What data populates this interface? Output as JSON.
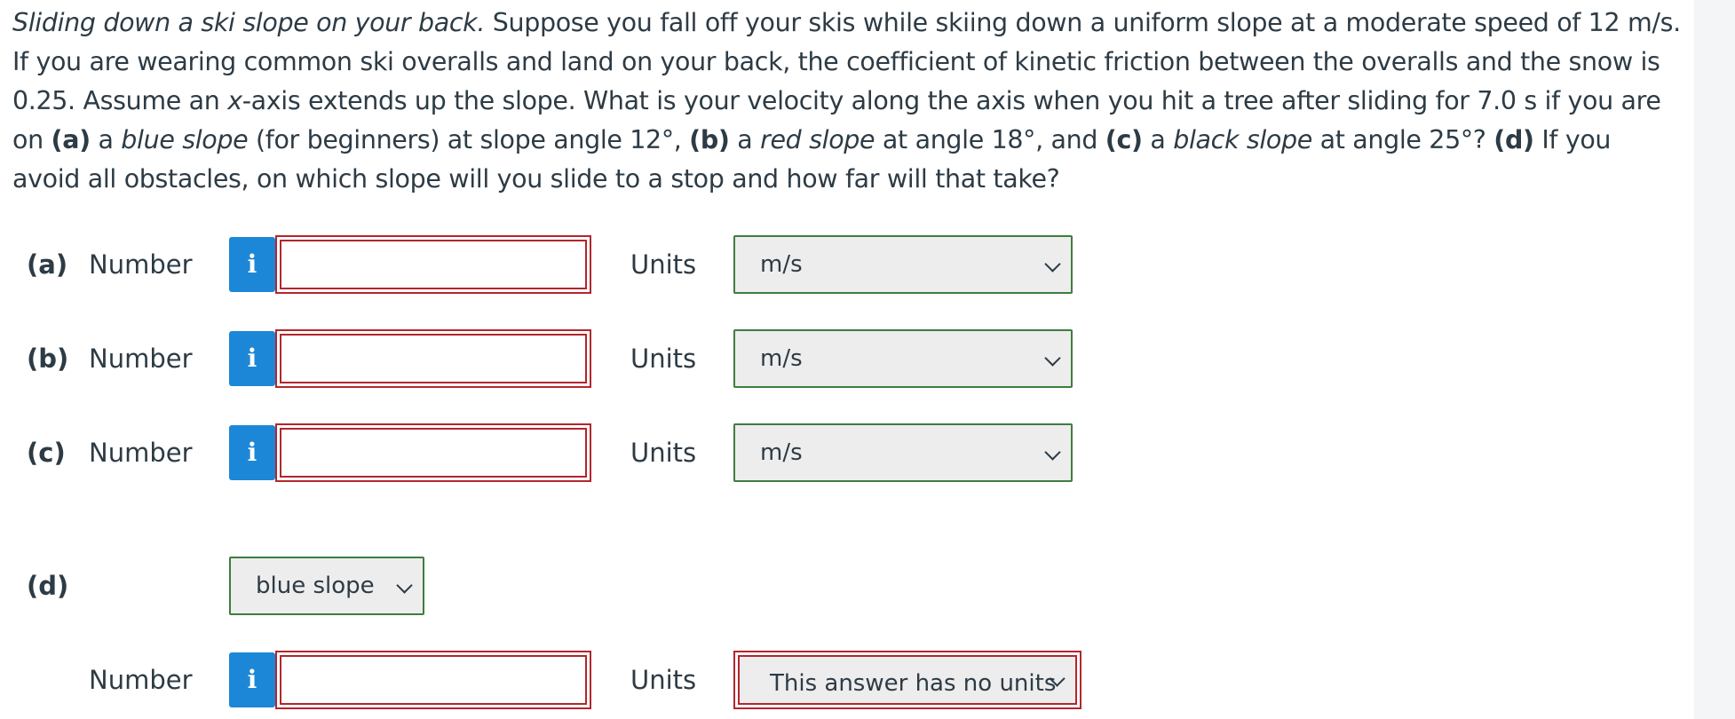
{
  "question": {
    "title_italic": "Sliding down a ski slope on your back.",
    "s1": " Suppose you fall off your skis while skiing down a uniform slope at a moderate speed of 12 m/s. If you are wearing common ski overalls and land on your back, the coefficient of kinetic friction between the overalls and the snow is 0.25. Assume an ",
    "x_italic": "x",
    "s2": "-axis extends up the slope. What is your velocity along the axis when you hit a tree after sliding for 7.0 s if you are on ",
    "a_bold": "(a)",
    "s3": " a ",
    "blue_italic": "blue slope",
    "s4": " (for beginners) at slope angle 12°, ",
    "b_bold": "(b)",
    "s5": " a ",
    "red_italic": "red slope",
    "s6": " at angle 18°, and ",
    "c_bold": "(c)",
    "s7": " a ",
    "black_italic": "black slope",
    "s8": " at angle 25°? ",
    "d_bold": "(d)",
    "s9": " If you avoid all obstacles, on which slope will you slide to a stop and how far will that take?"
  },
  "parts": [
    {
      "label": "(a)",
      "number_label": "Number",
      "info_icon": "i",
      "answer_value": "",
      "units_label": "Units",
      "units_value": "m/s"
    },
    {
      "label": "(b)",
      "number_label": "Number",
      "info_icon": "i",
      "answer_value": "",
      "units_label": "Units",
      "units_value": "m/s"
    },
    {
      "label": "(c)",
      "number_label": "Number",
      "info_icon": "i",
      "answer_value": "",
      "units_label": "Units",
      "units_value": "m/s"
    }
  ],
  "part_d": {
    "label": "(d)",
    "slope_select_value": "blue slope",
    "number_label": "Number",
    "info_icon": "i",
    "answer_value": "",
    "units_label": "Units",
    "units_value": "This answer has no units"
  },
  "colors": {
    "info_button": "#1d87d7",
    "error_border": "#b3262c",
    "valid_border": "#3e7d3e",
    "text": "#2d3b45"
  }
}
